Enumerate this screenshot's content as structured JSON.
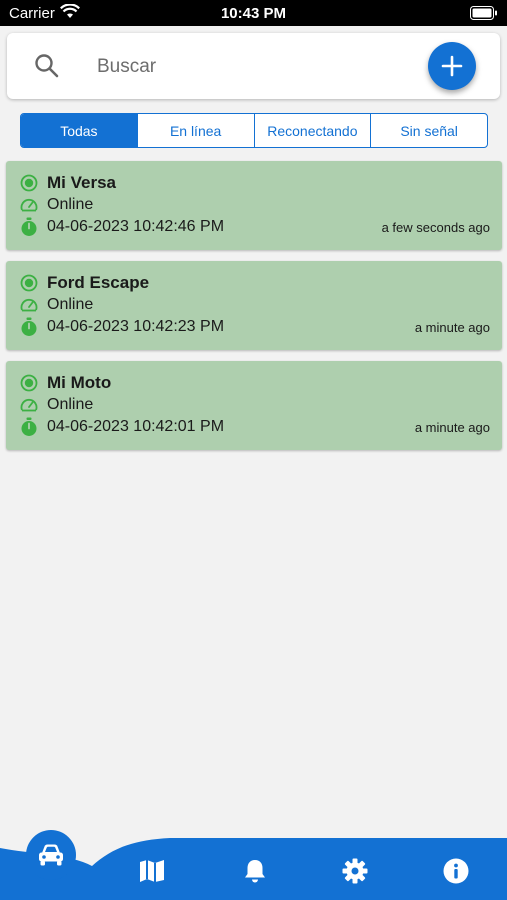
{
  "status_bar": {
    "carrier": "Carrier",
    "time": "10:43 PM"
  },
  "search": {
    "placeholder": "Buscar"
  },
  "filters": {
    "segments": [
      {
        "label": "Todas",
        "active": true
      },
      {
        "label": "En línea",
        "active": false
      },
      {
        "label": "Reconectando",
        "active": false
      },
      {
        "label": "Sin señal",
        "active": false
      }
    ]
  },
  "vehicles": [
    {
      "name": "Mi Versa",
      "status": "Online",
      "timestamp": "04-06-2023 10:42:46 PM",
      "ago": "a few seconds ago"
    },
    {
      "name": "Ford Escape",
      "status": "Online",
      "timestamp": "04-06-2023 10:42:23 PM",
      "ago": "a minute ago"
    },
    {
      "name": "Mi Moto",
      "status": "Online",
      "timestamp": "04-06-2023 10:42:01 PM",
      "ago": "a minute ago"
    }
  ],
  "colors": {
    "accent": "#1371d3",
    "card_bg": "#aecfae",
    "online_green": "#3cb043"
  },
  "bottom_nav": {
    "items": [
      "car-icon",
      "map-icon",
      "bell-icon",
      "gear-icon",
      "info-icon"
    ],
    "active": "car-icon"
  }
}
